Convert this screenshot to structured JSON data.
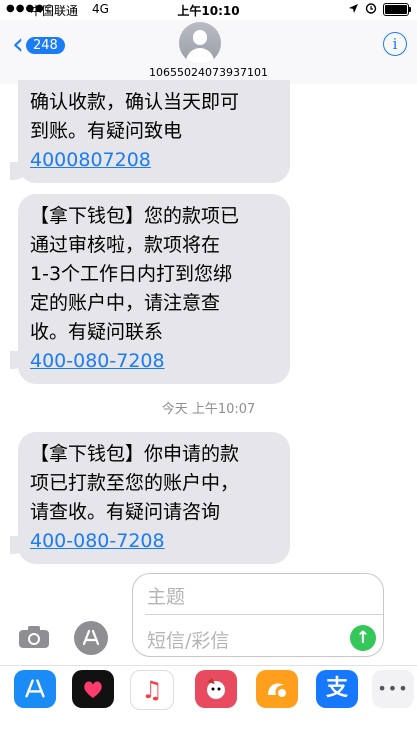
{
  "status_bar": {
    "signal": "●●●●○",
    "carrier": "中国联通",
    "network": "4G",
    "time": "上午10:10",
    "icons": [
      "location-icon",
      "alarm-icon",
      "battery-icon"
    ]
  },
  "header": {
    "back_badge": "248",
    "contact": "10655024073937101",
    "info": "i"
  },
  "messages": [
    {
      "lines": [
        "确认收款，确认当天即可",
        "到账。有疑问致电"
      ],
      "link": "4000807208"
    },
    {
      "lines": [
        "【拿下钱包】您的款项已",
        "通过审核啦，款项将在",
        "1-3个工作日内打到您绑",
        "定的账户中，请注意查",
        "收。有疑问联系"
      ],
      "link": "400-080-7208"
    },
    {
      "lines": [
        "【拿下钱包】你申请的款",
        "项已打款至您的账户中，",
        "请查收。有疑问请咨询"
      ],
      "link": "400-080-7208"
    }
  ],
  "timestamp": "今天 上午10:07",
  "composer": {
    "subject_placeholder": "主题",
    "body_placeholder": "短信/彩信"
  },
  "drawer_apps": [
    "app-store-icon",
    "digital-touch-icon",
    "music-icon",
    "sticker-icon",
    "uc-browser-icon",
    "alipay-icon",
    "more-icon"
  ],
  "colors": {
    "accent": "#1b7cf5",
    "bubble": "#e5e5ea",
    "send": "#34c759"
  }
}
